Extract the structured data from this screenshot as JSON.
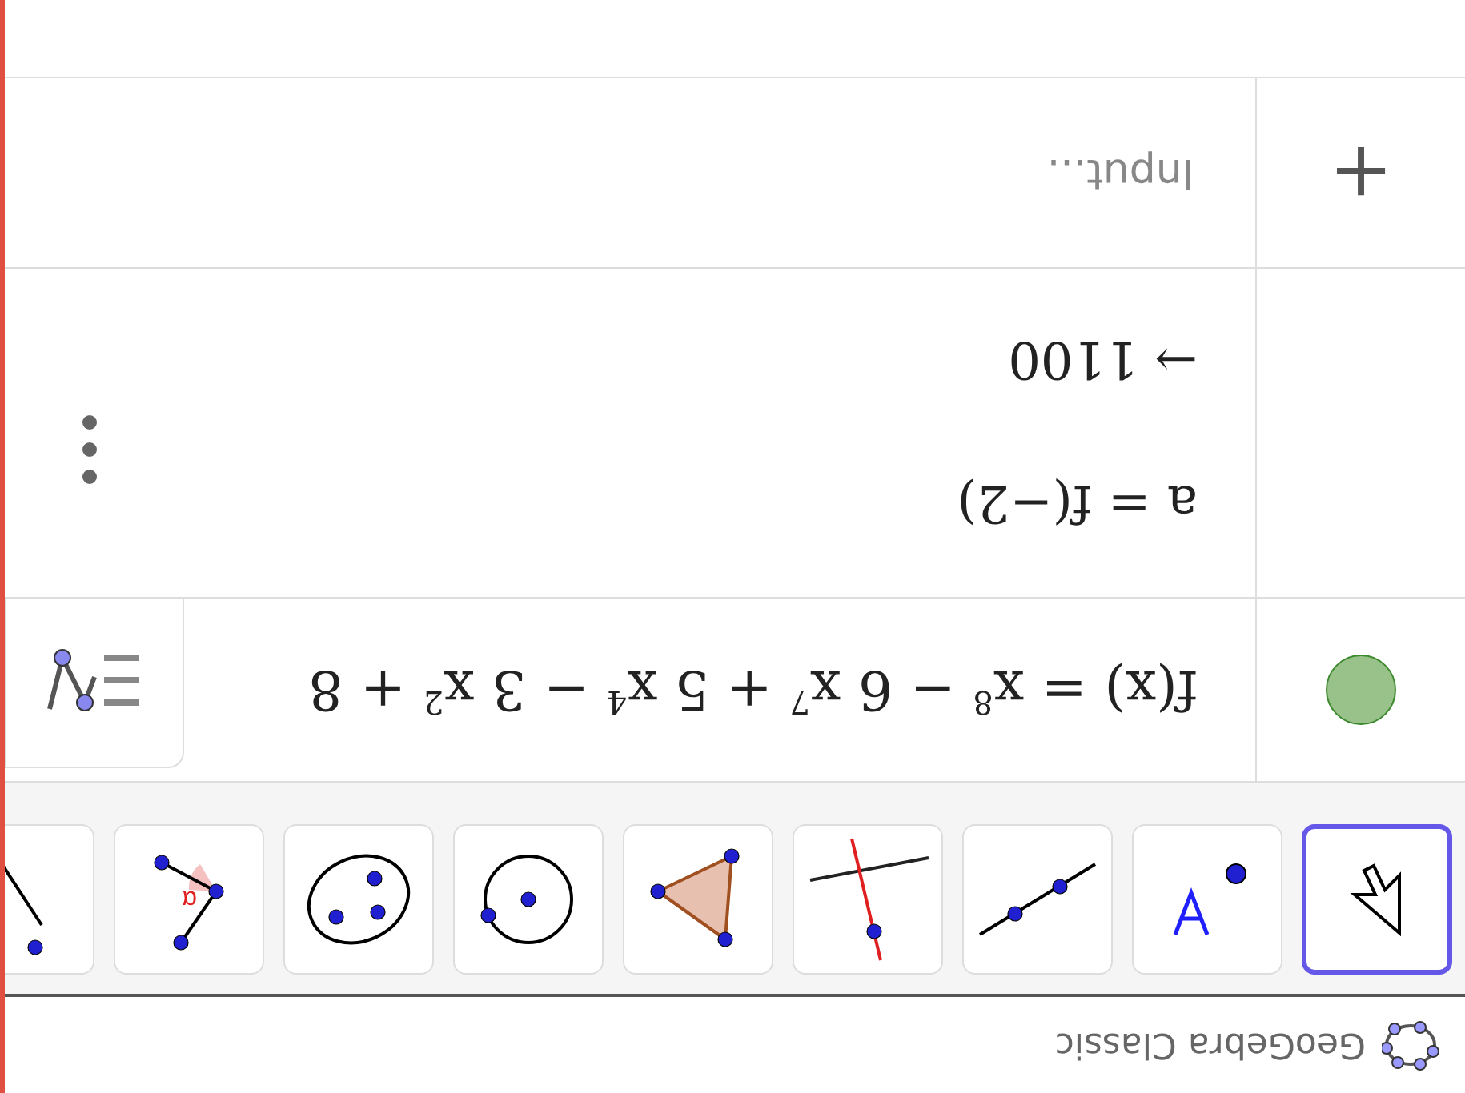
{
  "upside_down": true,
  "window": {
    "title": "GeoGebra Classic"
  },
  "toolbar": {
    "tools": [
      {
        "kind": "move",
        "selected": true
      },
      {
        "kind": "point",
        "selected": false
      },
      {
        "kind": "line",
        "selected": false
      },
      {
        "kind": "perpendicular",
        "selected": false
      },
      {
        "kind": "polygon",
        "selected": false
      },
      {
        "kind": "circle",
        "selected": false
      },
      {
        "kind": "conic",
        "selected": false
      },
      {
        "kind": "angle",
        "selected": false,
        "symbol": "α"
      },
      {
        "kind": "segment",
        "selected": false
      }
    ]
  },
  "algebra": {
    "rows": [
      {
        "kind": "function",
        "visible": true,
        "color": "#99c18a",
        "expression": "f(x) = x$^{8}$ − 6 x$^{7}$ + 5 x$^{4}$ − 3 x$^{2}$ + 8"
      },
      {
        "kind": "value",
        "definition": "a = f(−2)",
        "result": "→ 1100"
      },
      {
        "kind": "input",
        "button": "+",
        "placeholder": "Input..."
      }
    ]
  }
}
